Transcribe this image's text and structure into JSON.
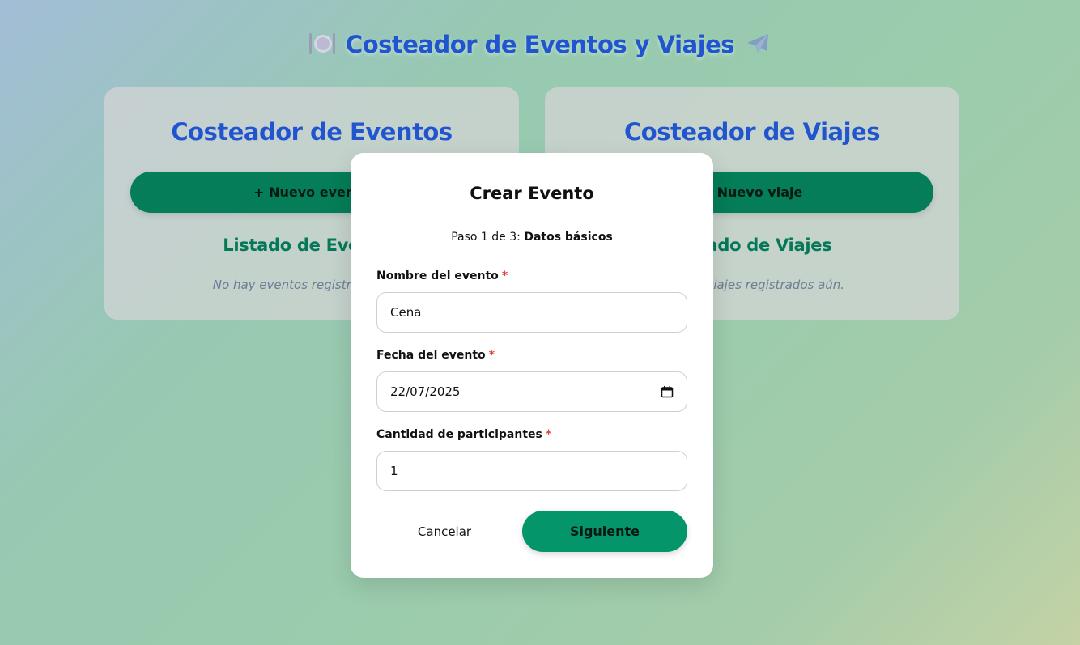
{
  "header": {
    "title": "Costeador de Eventos y Viajes",
    "left_icon": "plate-cutlery-icon",
    "right_icon": "airplane-icon"
  },
  "events_card": {
    "title": "Costeador de Eventos",
    "new_button": "+ Nuevo evento",
    "list_title": "Listado de Eventos",
    "empty_text": "No hay eventos registrados aún."
  },
  "trips_card": {
    "title": "Costeador de Viajes",
    "new_button": "+ Nuevo viaje",
    "list_title": "Listado de Viajes",
    "empty_text": "No hay viajes registrados aún."
  },
  "modal": {
    "title": "Crear Evento",
    "step_prefix": "Paso 1 de 3:",
    "step_name": "Datos básicos",
    "required_marker": "*",
    "fields": [
      {
        "label": "Nombre del evento",
        "value": "Cena"
      },
      {
        "label": "Fecha del evento",
        "value": "22/07/2025"
      },
      {
        "label": "Cantidad de participantes",
        "value": "1"
      }
    ],
    "cancel_label": "Cancelar",
    "next_label": "Siguiente"
  },
  "colors": {
    "title_blue": "#2155cf",
    "primary_green": "#047d58",
    "next_green": "#05956a",
    "required_red": "#e53e3e"
  }
}
